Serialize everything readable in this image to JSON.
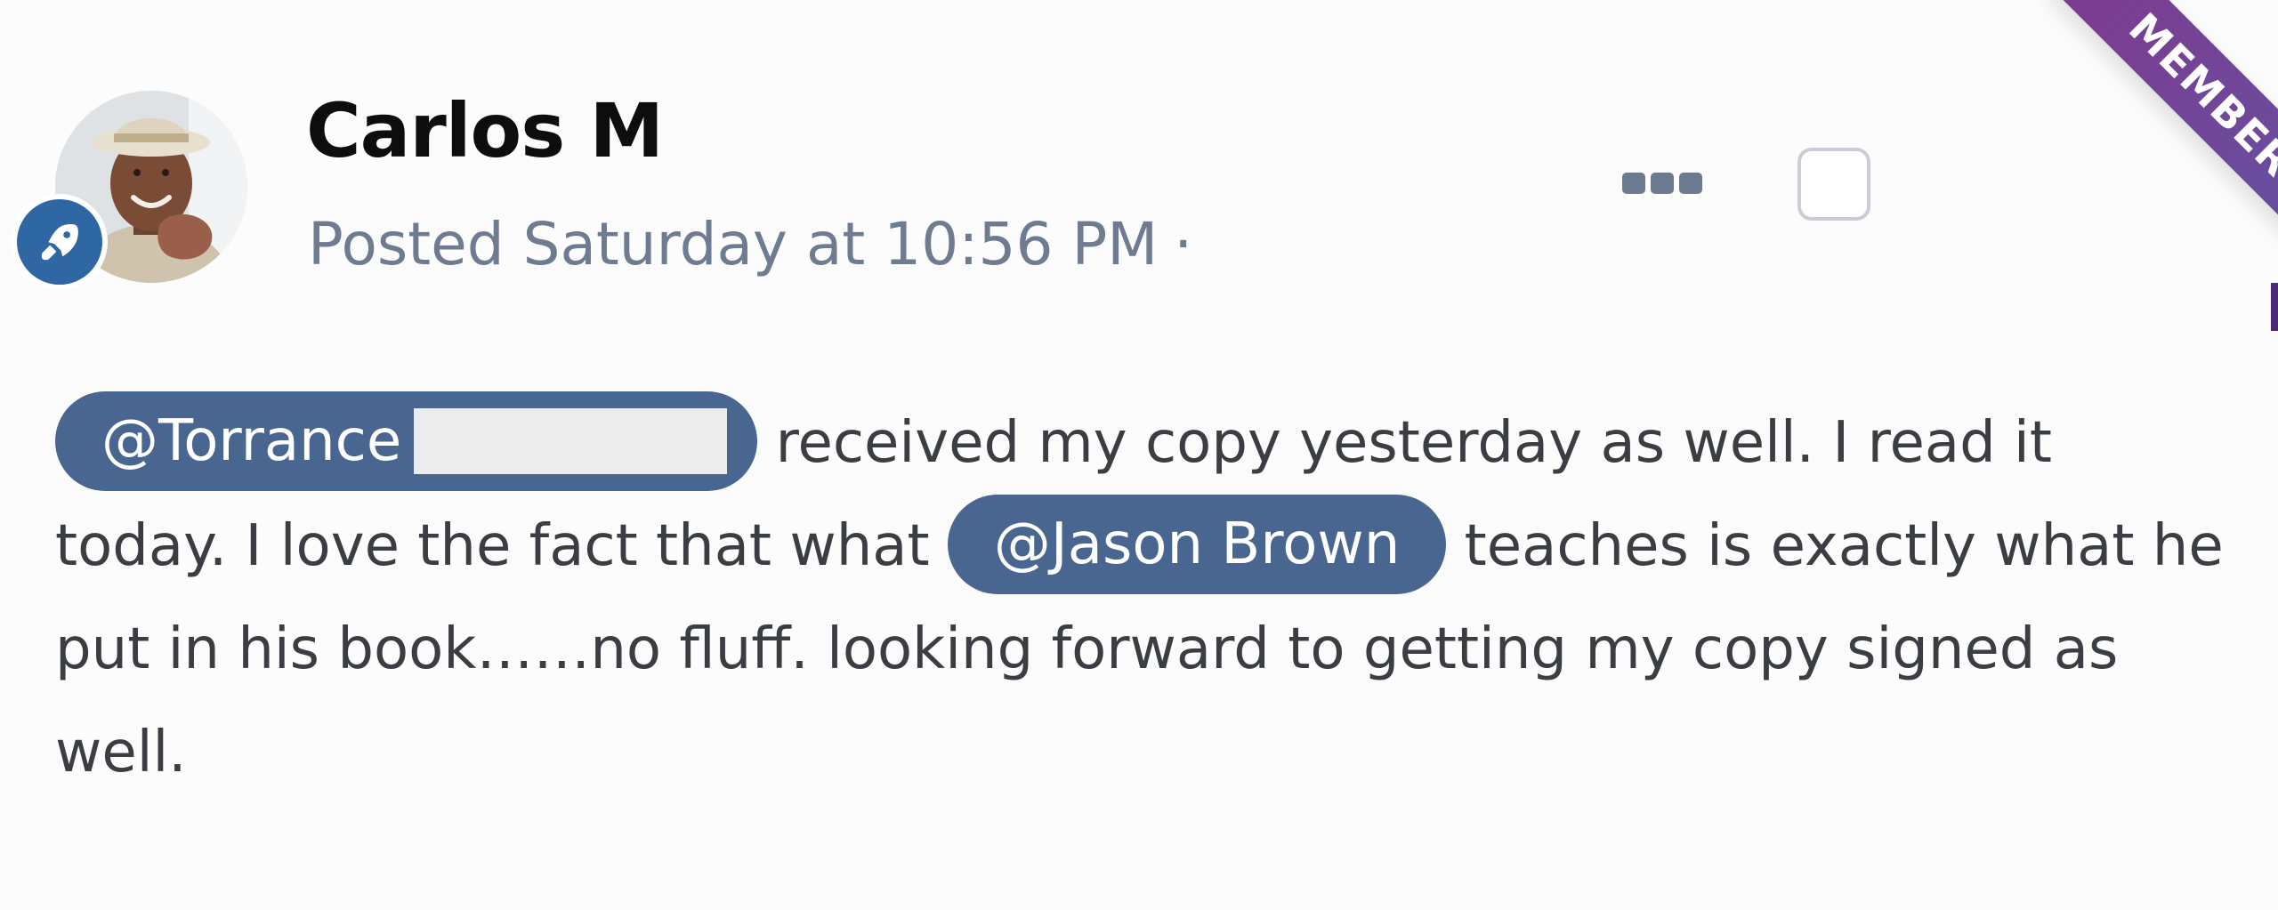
{
  "post": {
    "author": {
      "name": "Carlos M"
    },
    "meta": {
      "posted_label": "Posted Saturday at 10:56 PM",
      "separator": "·"
    },
    "ribbon": {
      "label": "MEMBER ++",
      "color": "#6d4a9c"
    },
    "rank_badge": {
      "icon": "rocket-icon",
      "color": "#2f66a4"
    },
    "body": {
      "mention_1": "@Torrance",
      "text_1": " received my copy yesterday as well.  I read it today.  I love the fact that what ",
      "mention_2": "@Jason Brown",
      "text_2": " teaches is exactly what he put in his book……no fluff.  looking forward to getting my copy signed as well."
    },
    "colors": {
      "mention_bg": "#496690",
      "meta_text": "#6e7b90",
      "body_text": "#3a3d42"
    }
  }
}
